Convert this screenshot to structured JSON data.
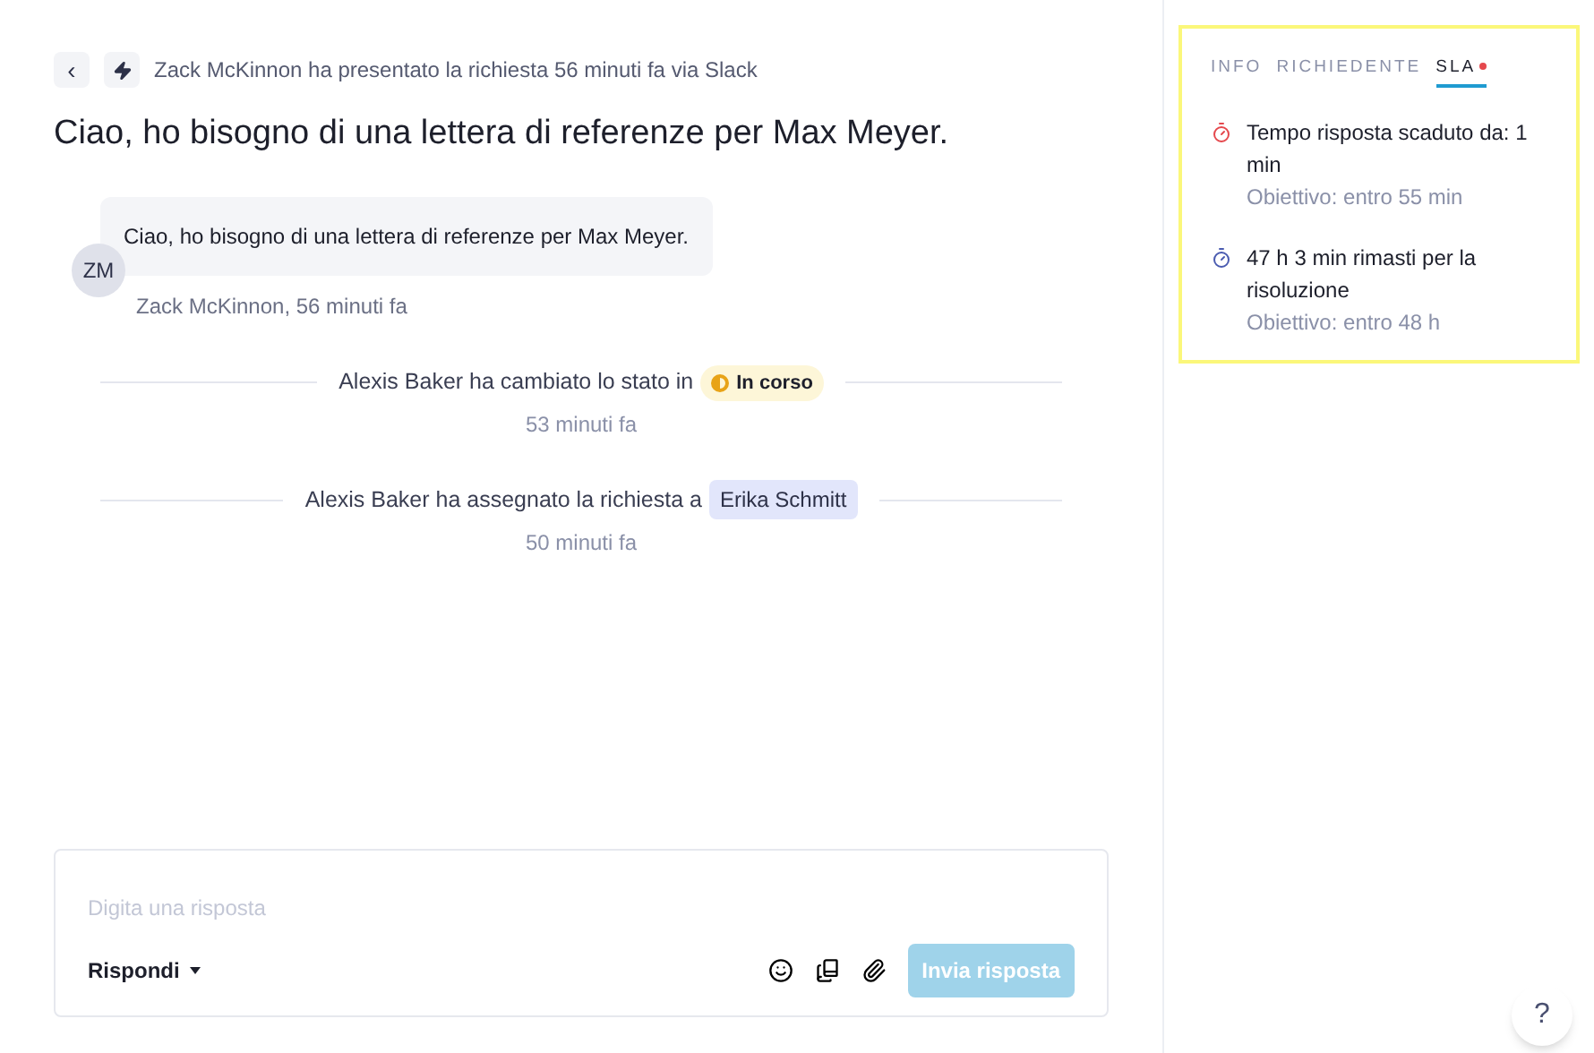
{
  "header": {
    "back": "‹",
    "summary": "Zack McKinnon ha presentato la richiesta 56 minuti fa via Slack"
  },
  "title": "Ciao, ho bisogno di una lettera di referenze per Max Meyer.",
  "message": {
    "initials": "ZM",
    "text": "Ciao, ho bisogno di una lettera di referenze per Max Meyer.",
    "author": "Zack McKinnon",
    "time": ", 56 minuti fa"
  },
  "events": [
    {
      "kind": "status",
      "text": "Alexis Baker ha cambiato lo stato in",
      "badge": "In corso",
      "time": "53 minuti fa"
    },
    {
      "kind": "assign",
      "text": "Alexis Baker ha assegnato la richiesta a",
      "badge": "Erika Schmitt",
      "time": "50 minuti fa"
    }
  ],
  "composer": {
    "placeholder": "Digita una risposta",
    "mode": "Rispondi",
    "send": "Invia risposta",
    "send_disabled": true
  },
  "tabs": [
    {
      "label": "INFO",
      "selected": false,
      "alert": false
    },
    {
      "label": "RICHIEDENTE",
      "selected": false,
      "alert": false
    },
    {
      "label": "SLA",
      "selected": true,
      "alert": true
    }
  ],
  "sla": [
    {
      "text": "Tempo risposta scaduto da: 1 min",
      "goal": "Obiettivo: entro 55 min",
      "color": "#e5484d"
    },
    {
      "text": "47 h 3 min rimasti per la risoluzione",
      "goal": "Obiettivo: entro 48 h",
      "color": "#4a5bb0"
    }
  ],
  "help": "?"
}
